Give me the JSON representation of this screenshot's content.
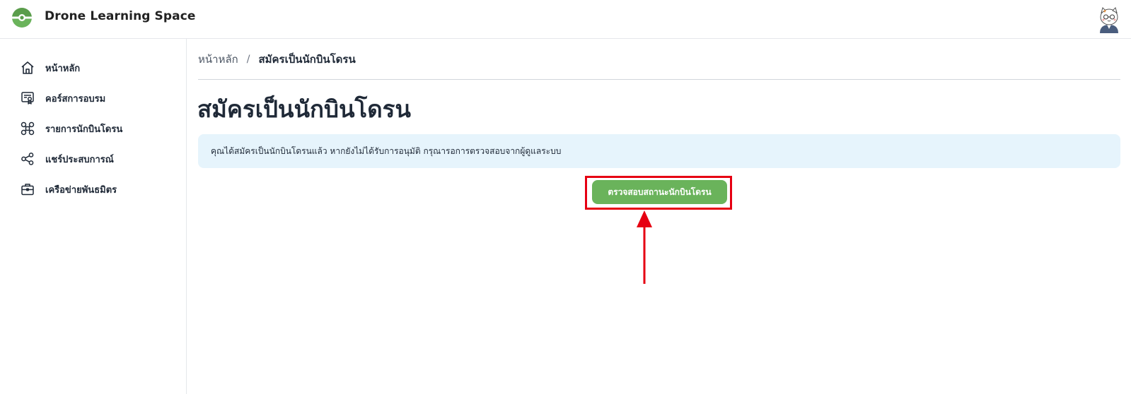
{
  "app": {
    "title": "Drone Learning Space"
  },
  "sidebar": {
    "items": [
      {
        "label": "หน้าหลัก",
        "icon": "home-icon"
      },
      {
        "label": "คอร์สการอบรม",
        "icon": "certificate-icon"
      },
      {
        "label": "รายการนักบินโดรน",
        "icon": "drone-icon"
      },
      {
        "label": "แชร์ประสบการณ์",
        "icon": "share-icon"
      },
      {
        "label": "เครือข่ายพันธมิตร",
        "icon": "briefcase-icon"
      }
    ]
  },
  "breadcrumb": {
    "home": "หน้าหลัก",
    "separator": "/",
    "current": "สมัครเป็นนักบินโดรน"
  },
  "page": {
    "title": "สมัครเป็นนักบินโดรน",
    "alert_text": "คุณได้สมัครเป็นนักบินโดรนแล้ว หากยังไม่ได้รับการอนุมัติ กรุณารอการตรวจสอบจากผู้ดูแลระบบ",
    "check_button_label": "ตรวจสอบสถานะนักบินโดรน"
  },
  "colors": {
    "brand_green": "#6ab35b",
    "alert_bg": "#e6f4fc",
    "annotation_red": "#e60012"
  }
}
